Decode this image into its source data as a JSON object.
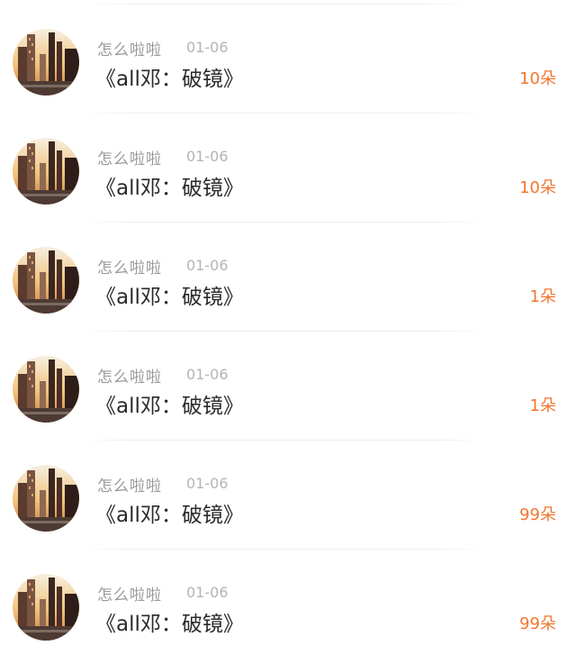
{
  "colors": {
    "background": "#ffffff",
    "username": "#9a9a9a",
    "date": "#b4b4b4",
    "title": "#2a2a2a",
    "count": "#f2762e"
  },
  "items": [
    {
      "avatar_icon": "city-sunset-avatar",
      "username": "怎么啦啦",
      "date": "01-06",
      "title": "《all邓：破镜》",
      "count": "10朵"
    },
    {
      "avatar_icon": "city-sunset-avatar",
      "username": "怎么啦啦",
      "date": "01-06",
      "title": "《all邓：破镜》",
      "count": "10朵"
    },
    {
      "avatar_icon": "city-sunset-avatar",
      "username": "怎么啦啦",
      "date": "01-06",
      "title": "《all邓：破镜》",
      "count": "1朵"
    },
    {
      "avatar_icon": "city-sunset-avatar",
      "username": "怎么啦啦",
      "date": "01-06",
      "title": "《all邓：破镜》",
      "count": "1朵"
    },
    {
      "avatar_icon": "city-sunset-avatar",
      "username": "怎么啦啦",
      "date": "01-06",
      "title": "《all邓：破镜》",
      "count": "99朵"
    },
    {
      "avatar_icon": "city-sunset-avatar",
      "username": "怎么啦啦",
      "date": "01-06",
      "title": "《all邓：破镜》",
      "count": "99朵"
    }
  ]
}
